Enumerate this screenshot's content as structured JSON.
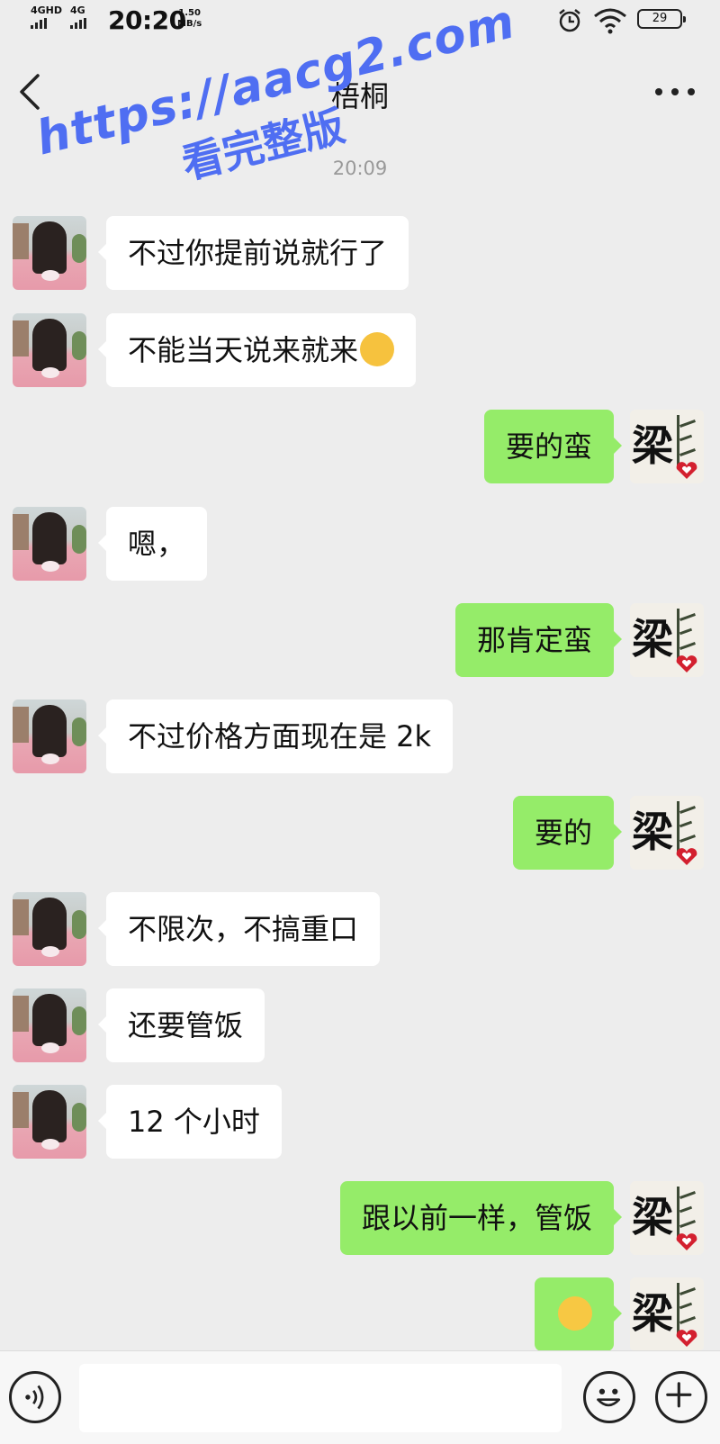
{
  "status_bar": {
    "network1": "4GHD",
    "network2": "4G",
    "time": "20:20",
    "speed_value": "1.50",
    "speed_unit": "MB/s",
    "battery": "29"
  },
  "nav": {
    "title": "梧桐"
  },
  "chat": {
    "timestamp": "20:09",
    "messages": [
      {
        "side": "in",
        "text": "不过你提前说就行了"
      },
      {
        "side": "in",
        "text": "不能当天说来就来"
      },
      {
        "side": "out",
        "text": "要的蛮"
      },
      {
        "side": "in",
        "text": "嗯，"
      },
      {
        "side": "out",
        "text": "那肯定蛮"
      },
      {
        "side": "in",
        "text": "不过价格方面现在是 2k"
      },
      {
        "side": "out",
        "text": "要的"
      },
      {
        "side": "in",
        "text": "不限次，不搞重口"
      },
      {
        "side": "in",
        "text": "还要管饭"
      },
      {
        "side": "in",
        "text": "12 个小时"
      },
      {
        "side": "out",
        "text": "跟以前一样，管饭"
      },
      {
        "side": "out",
        "text": ""
      }
    ]
  },
  "avatars": {
    "self_char": "梁"
  },
  "watermark": {
    "url": "https://aacg2.com",
    "caption": "看完整版"
  },
  "input": {
    "placeholder": ""
  },
  "icons": {
    "back": "back-arrow-icon",
    "more": "more-icon",
    "voice": "voice-icon",
    "emoji": "emoji-icon",
    "plus": "plus-icon"
  },
  "colors": {
    "outgoing_bubble": "#95ec69",
    "incoming_bubble": "#ffffff",
    "background": "#ededed",
    "watermark": "#4f6ef2"
  }
}
